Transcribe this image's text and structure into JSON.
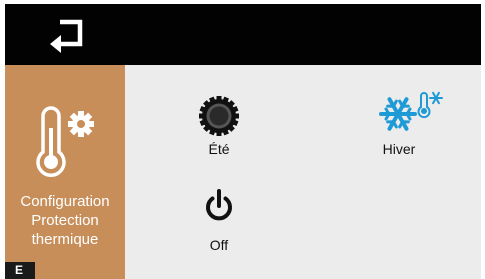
{
  "topbar": {
    "back_icon": "return-arrow-icon"
  },
  "sidebar": {
    "icon": "thermometer-gear-icon",
    "label_lines": [
      "Configuration",
      "Protection",
      "thermique"
    ],
    "badge": "E"
  },
  "options": [
    {
      "id": "ete",
      "label": "Été",
      "icon": "sun-gear-icon"
    },
    {
      "id": "hiver",
      "label": "Hiver",
      "icon": "snowflake-thermometer-icon"
    },
    {
      "id": "off",
      "label": "Off",
      "icon": "power-icon"
    }
  ],
  "colors": {
    "topbar": "#020202",
    "sidebar": "#c78e5a",
    "content_bg": "#ececec",
    "winter_blue": "#1e9ad6"
  }
}
